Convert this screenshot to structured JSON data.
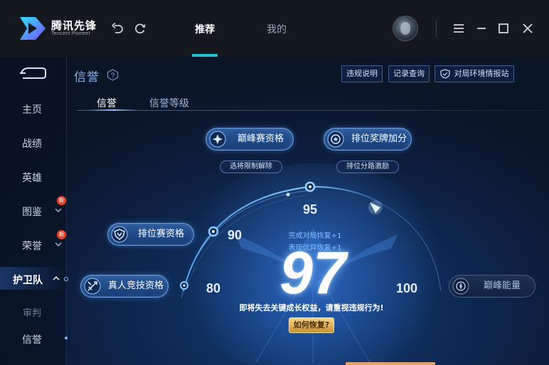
{
  "app": {
    "logo_cn": "腾讯先锋",
    "logo_en": "Tencent Pioneer"
  },
  "nav": {
    "tabs": [
      {
        "label": "推荐",
        "active": true
      },
      {
        "label": "我的",
        "active": false
      }
    ]
  },
  "window_controls": [
    "menu-icon",
    "minimize-icon",
    "maximize-icon",
    "close-icon"
  ],
  "sidebar": {
    "items": [
      {
        "label": "主页"
      },
      {
        "label": "战绩"
      },
      {
        "label": "英雄"
      },
      {
        "label": "图鉴",
        "badge": "新"
      },
      {
        "label": "荣誉",
        "badge": "新"
      },
      {
        "label": "护卫队",
        "active": true
      },
      {
        "label": "审判"
      },
      {
        "label": "信誉"
      }
    ]
  },
  "header": {
    "title": "信誉",
    "buttons": [
      "违规说明",
      "记录查询",
      "对局环境情报站"
    ]
  },
  "subtabs": [
    {
      "label": "信誉",
      "active": true
    },
    {
      "label": "信誉等级",
      "active": false
    }
  ],
  "tiers": {
    "peak": {
      "label": "巅峰赛资格",
      "note": "选将限制解除"
    },
    "rank_bonus": {
      "label": "排位奖牌加分",
      "note": "排位分路激励"
    },
    "rank": {
      "label": "排位赛资格"
    },
    "human": {
      "label": "真人竞技资格"
    },
    "energy": {
      "label": "巅峰能量"
    }
  },
  "scale": {
    "marks": [
      "80",
      "90",
      "95",
      "100"
    ]
  },
  "score": {
    "value": "97",
    "recover_lines": [
      "完成对局恢复+1",
      "表现优异恢复+1"
    ],
    "warning": "即将失去关键成长权益，请重视违规行为!",
    "how_button": "如何恢复?"
  },
  "colors": {
    "accent": "#1fc1d6",
    "badge_red": "#e8452c",
    "gold": "#d9a94a"
  }
}
